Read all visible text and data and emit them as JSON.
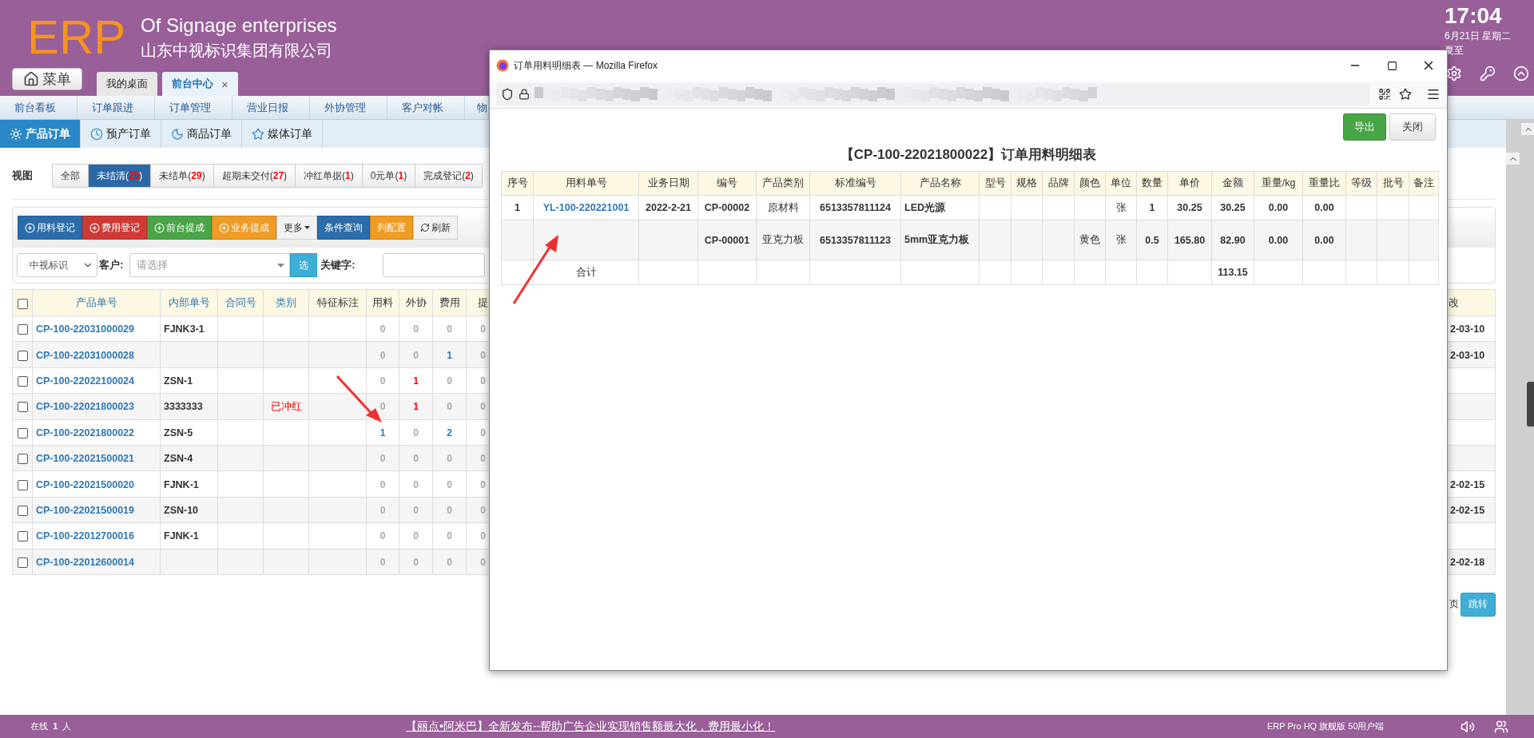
{
  "header": {
    "logo": "ERP",
    "title": "Of Signage enterprises",
    "company": "山东中视标识集团有限公司",
    "menu_button": "菜单",
    "tabs": [
      {
        "label": "我的桌面",
        "selected": false
      },
      {
        "label": "前台中心",
        "selected": true,
        "close": "×"
      }
    ],
    "clock": {
      "time": "17:04",
      "date": "6月21日 星期二",
      "term": "夏至"
    }
  },
  "nav": [
    "前台看板",
    "订单跟进",
    "订单管理",
    "营业日报",
    "外协管理",
    "客户对帐",
    "物"
  ],
  "order_tabs": [
    {
      "label": "产品订单",
      "selected": true
    },
    {
      "label": "预产订单",
      "selected": false
    },
    {
      "label": "商品订单",
      "selected": false
    },
    {
      "label": "媒体订单",
      "selected": false
    }
  ],
  "view": {
    "label": "视图",
    "filters": [
      {
        "prefix": "全部",
        "selected": false
      },
      {
        "prefix": "未结清(",
        "count": "25",
        "suffix": ")",
        "selected": true
      },
      {
        "prefix": "未结单(",
        "count": "29",
        "suffix": ")",
        "selected": false
      },
      {
        "prefix": "超期未交付(",
        "count": "27",
        "suffix": ")",
        "selected": false
      },
      {
        "prefix": "冲红单据(",
        "count": "1",
        "suffix": ")",
        "selected": false
      },
      {
        "prefix": "0元单(",
        "count": "1",
        "suffix": ")",
        "selected": false
      },
      {
        "prefix": "完成登记(",
        "count": "2",
        "suffix": ")",
        "selected": false
      }
    ]
  },
  "toolbar": [
    {
      "label": "用料登记",
      "kind": "add",
      "color": "#2b6cab"
    },
    {
      "label": "费用登记",
      "kind": "add",
      "color": "#d03a35"
    },
    {
      "label": "前台提成",
      "kind": "add",
      "color": "#4aa448"
    },
    {
      "label": "业务提成",
      "kind": "add",
      "color": "#ef9c25"
    },
    {
      "label": "更多",
      "kind": "dropdown",
      "color": "#f2f2f2"
    },
    {
      "label": "条件查询",
      "kind": "plain",
      "color": "#2b6cab"
    },
    {
      "label": "列配置",
      "kind": "plain",
      "color": "#ef9c25"
    },
    {
      "label": "刷新",
      "kind": "refresh",
      "color": "#f2f2f2"
    }
  ],
  "filter": {
    "company": "中视标识",
    "customer_label": "客户:",
    "customer_placeholder": "请选择",
    "pick_button": "选",
    "keyword_label": "关键字:"
  },
  "table": {
    "header_checked": false,
    "columns": [
      "产品单号",
      "内部单号",
      "合同号",
      "类别",
      "特征标注",
      "用料",
      "外协",
      "费用",
      "提",
      "改"
    ],
    "rows": [
      {
        "checked": false,
        "order_no": "CP-100-22031000029",
        "internal_no": "FJNK3-1",
        "counts": [
          {
            "value": "0",
            "kind": "zero"
          },
          {
            "value": "0",
            "kind": "zero"
          },
          {
            "value": "0",
            "kind": "zero"
          },
          {
            "value": "0",
            "kind": "zero"
          }
        ],
        "date": "2-03-10"
      },
      {
        "checked": false,
        "order_no": "CP-100-22031000028",
        "counts": [
          {
            "value": "0",
            "kind": "zero"
          },
          {
            "value": "0",
            "kind": "zero"
          },
          {
            "value": "1",
            "kind": "link"
          },
          {
            "value": "0",
            "kind": "zero"
          }
        ],
        "date": "2-03-10"
      },
      {
        "checked": false,
        "order_no": "CP-100-22022100024",
        "internal_no": "ZSN-1",
        "counts": [
          {
            "value": "0",
            "kind": "zero"
          },
          {
            "value": "1",
            "kind": "alert"
          },
          {
            "value": "0",
            "kind": "zero"
          },
          {
            "value": "0",
            "kind": "zero"
          }
        ]
      },
      {
        "checked": false,
        "order_no": "CP-100-22021800023",
        "internal_no": "3333333",
        "category": "已冲红",
        "counts": [
          {
            "value": "0",
            "kind": "zero"
          },
          {
            "value": "1",
            "kind": "alert"
          },
          {
            "value": "0",
            "kind": "zero"
          },
          {
            "value": "0",
            "kind": "zero"
          }
        ]
      },
      {
        "checked": false,
        "order_no": "CP-100-22021800022",
        "internal_no": "ZSN-5",
        "counts": [
          {
            "value": "1",
            "kind": "link"
          },
          {
            "value": "0",
            "kind": "zero"
          },
          {
            "value": "2",
            "kind": "link"
          },
          {
            "value": "0",
            "kind": "zero"
          }
        ]
      },
      {
        "checked": false,
        "order_no": "CP-100-22021500021",
        "internal_no": "ZSN-4",
        "counts": [
          {
            "value": "0",
            "kind": "zero"
          },
          {
            "value": "0",
            "kind": "zero"
          },
          {
            "value": "0",
            "kind": "zero"
          },
          {
            "value": "0",
            "kind": "zero"
          }
        ]
      },
      {
        "checked": false,
        "order_no": "CP-100-22021500020",
        "internal_no": "FJNK-1",
        "counts": [
          {
            "value": "0",
            "kind": "zero"
          },
          {
            "value": "0",
            "kind": "zero"
          },
          {
            "value": "0",
            "kind": "zero"
          },
          {
            "value": "0",
            "kind": "zero"
          }
        ],
        "date": "2-02-15"
      },
      {
        "checked": false,
        "order_no": "CP-100-22021500019",
        "internal_no": "ZSN-10",
        "counts": [
          {
            "value": "0",
            "kind": "zero"
          },
          {
            "value": "0",
            "kind": "zero"
          },
          {
            "value": "0",
            "kind": "zero"
          },
          {
            "value": "0",
            "kind": "zero"
          }
        ],
        "date": "2-02-15"
      },
      {
        "checked": false,
        "order_no": "CP-100-22012700016",
        "internal_no": "FJNK-1",
        "counts": [
          {
            "value": "0",
            "kind": "zero"
          },
          {
            "value": "0",
            "kind": "zero"
          },
          {
            "value": "0",
            "kind": "zero"
          },
          {
            "value": "0",
            "kind": "zero"
          }
        ]
      },
      {
        "checked": false,
        "order_no": "CP-100-22012600014",
        "counts": [
          {
            "value": "0",
            "kind": "zero"
          },
          {
            "value": "0",
            "kind": "zero"
          },
          {
            "value": "0",
            "kind": "zero"
          },
          {
            "value": "0",
            "kind": "zero"
          }
        ],
        "date": "2-02-18"
      }
    ]
  },
  "pager": {
    "page_suffix": "页",
    "jump_button": "跳转"
  },
  "popup": {
    "title": "订单用料明细表 — Mozilla Firefox",
    "buttons": [
      {
        "label": "导出",
        "kind": "primary"
      },
      {
        "label": "关闭",
        "kind": "default"
      }
    ],
    "heading": "【CP-100-22021800022】订单用料明细表",
    "columns": [
      "序号",
      "用料单号",
      "业务日期",
      "编号",
      "产品类别",
      "标准编号",
      "产品名称",
      "型号",
      "规格",
      "品牌",
      "颜色",
      "单位",
      "数量",
      "单价",
      "金额",
      "重量/kg",
      "重量比",
      "等级",
      "批号",
      "备注"
    ],
    "rows": [
      {
        "kind": "item",
        "cells": [
          "1",
          "YL-100-220221001",
          "2022-2-21",
          "CP-00002",
          "原材料",
          "6513357811124",
          "LED光源",
          null,
          null,
          null,
          null,
          "张",
          "1",
          "30.25",
          "30.25",
          "0.00",
          "0.00",
          null,
          null,
          null
        ]
      },
      {
        "kind": "item",
        "cells": [
          null,
          null,
          null,
          "CP-00001",
          "亚克力板",
          "6513357811123",
          "5mm亚克力板",
          null,
          null,
          null,
          "黄色",
          "张",
          "0.5",
          "165.80",
          "82.90",
          "0.00",
          "0.00",
          null,
          null,
          null
        ]
      },
      {
        "kind": "total",
        "cells": [
          null,
          "合计",
          null,
          null,
          null,
          null,
          null,
          null,
          null,
          null,
          null,
          null,
          null,
          null,
          "113.15",
          null,
          null,
          null,
          null,
          null
        ]
      }
    ]
  },
  "status_bar": {
    "online_label": "在线",
    "online_count": "1",
    "online_unit": "人",
    "announcement": "【丽点•阿米巴】全新发布--帮助广告企业实现销售额最大化，费用最小化！",
    "edition": "ERP Pro HQ 旗舰版 50用户端"
  }
}
